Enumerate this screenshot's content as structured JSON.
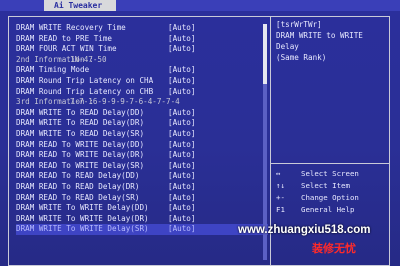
{
  "menu": {
    "active_tab": "Ai Tweaker"
  },
  "settings": [
    {
      "label": "DRAM WRITE Recovery Time",
      "value": "[Auto]",
      "type": "option"
    },
    {
      "label": "DRAM READ to PRE Time",
      "value": "[Auto]",
      "type": "option"
    },
    {
      "label": "DRAM FOUR ACT WIN Time",
      "value": "[Auto]",
      "type": "option"
    },
    {
      "label": "2nd Information :",
      "value": "1N-47-50",
      "type": "info"
    },
    {
      "label": "DRAM Timing Mode",
      "value": "[Auto]",
      "type": "option"
    },
    {
      "label": "DRAM Round Trip Latency on CHA",
      "value": "[Auto]",
      "type": "option"
    },
    {
      "label": "DRAM Round Trip Latency on CHB",
      "value": "[Auto]",
      "type": "option"
    },
    {
      "label": "3rd Information :",
      "value": "7-7-16-9-9-9-7-6-4-7-7-4",
      "type": "info"
    },
    {
      "label": "DRAM WRITE To READ Delay(DD)",
      "value": "[Auto]",
      "type": "option"
    },
    {
      "label": "DRAM WRITE To READ Delay(DR)",
      "value": "[Auto]",
      "type": "option"
    },
    {
      "label": "DRAM WRITE To READ Delay(SR)",
      "value": "[Auto]",
      "type": "option"
    },
    {
      "label": "DRAM READ To WRITE Delay(DD)",
      "value": "[Auto]",
      "type": "option"
    },
    {
      "label": "DRAM READ To WRITE Delay(DR)",
      "value": "[Auto]",
      "type": "option"
    },
    {
      "label": "DRAM READ To WRITE Delay(SR)",
      "value": "[Auto]",
      "type": "option"
    },
    {
      "label": "DRAM READ To READ Delay(DD)",
      "value": "[Auto]",
      "type": "option"
    },
    {
      "label": "DRAM READ To READ Delay(DR)",
      "value": "[Auto]",
      "type": "option"
    },
    {
      "label": "DRAM READ To READ Delay(SR)",
      "value": "[Auto]",
      "type": "option"
    },
    {
      "label": "DRAM WRITE To WRITE Delay(DD)",
      "value": "[Auto]",
      "type": "option"
    },
    {
      "label": "DRAM WRITE To WRITE Delay(DR)",
      "value": "[Auto]",
      "type": "option"
    },
    {
      "label": "DRAM WRITE To WRITE Delay(SR)",
      "value": "[Auto]",
      "type": "option",
      "selected": true
    }
  ],
  "help": {
    "line1": "[tsrWrTWr]",
    "line2": "DRAM WRITE to WRITE",
    "line3": "Delay",
    "line4": "(Same Rank)"
  },
  "keys": [
    {
      "key": "↔",
      "desc": "Select Screen"
    },
    {
      "key": "↑↓",
      "desc": "Select Item"
    },
    {
      "key": "+-",
      "desc": "Change Option"
    },
    {
      "key": "F1",
      "desc": "General Help"
    }
  ],
  "watermark": {
    "url": "www.zhuangxiu518.com",
    "text": "装修无忧"
  },
  "colors": {
    "background": "#2b2f9c",
    "menubar": "#3a3fb8",
    "active_tab": "#d8d9dc",
    "text": "#e8e9ff",
    "selected_row": "#3e44c4",
    "watermark_text": "#ff2a2a"
  }
}
